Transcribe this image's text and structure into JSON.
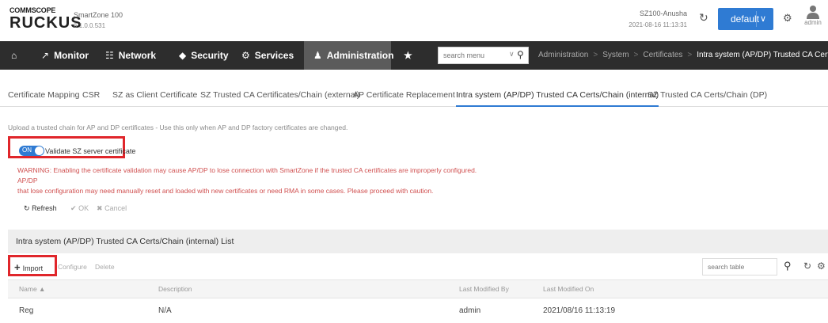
{
  "header": {
    "logo_top": "COMMSCOPE",
    "logo_main": "RUCKUS",
    "product_name": "SmartZone 100",
    "product_version": "6.1.0.0.531",
    "host_name": "SZ100-Anusha",
    "host_time": "2021-08-16  11:13:31",
    "domain_button": "default",
    "user_label": "admin"
  },
  "nav": {
    "items": [
      {
        "icon": "home-icon",
        "label": ""
      },
      {
        "icon": "monitor-icon",
        "label": "Monitor"
      },
      {
        "icon": "network-icon",
        "label": "Network"
      },
      {
        "icon": "shield-icon",
        "label": "Security"
      },
      {
        "icon": "gears-icon",
        "label": "Services"
      },
      {
        "icon": "admin-user-icon",
        "label": "Administration"
      },
      {
        "icon": "star-icon",
        "label": ""
      }
    ],
    "active": "Administration",
    "search_placeholder": "search menu",
    "breadcrumb": [
      "Administration",
      "System",
      "Certificates",
      "Intra system (AP/DP) Trusted CA Certs/Chain (int"
    ]
  },
  "tabs": [
    "Certificate Mapping",
    "CSR",
    "SZ as Client Certificate",
    "SZ Trusted CA Certificates/Chain (external)",
    "AP Certificate Replacement",
    "Intra system (AP/DP) Trusted CA Certs/Chain (internal)",
    "SZ Trusted CA Certs/Chain (DP)"
  ],
  "active_tab": "Intra system (AP/DP) Trusted CA Certs/Chain (internal)",
  "upload_note": "Upload a trusted chain for AP and DP certificates - Use this only when AP and DP factory certificates are changed.",
  "validate": {
    "toggle_state": "ON",
    "label": "Validate SZ server certificate"
  },
  "warning": {
    "line1": "WARNING: Enabling the certificate validation may cause AP/DP to lose connection with SmartZone if the trusted CA certificates are improperly configured. AP/DP",
    "line2": "that lose configuration may need manually reset and loaded with new certificates or need RMA in some cases. Please proceed with caution."
  },
  "actions": {
    "refresh": "Refresh",
    "ok": "OK",
    "cancel": "Cancel"
  },
  "list": {
    "title": "Intra system (AP/DP) Trusted CA Certs/Chain (internal) List",
    "import": "Import",
    "configure": "Configure",
    "delete": "Delete",
    "search_placeholder": "search table",
    "columns": [
      "Name ▲",
      "Description",
      "Last Modified By",
      "Last Modified On"
    ],
    "rows": [
      [
        "Reg",
        "N/A",
        "admin",
        "2021/08/16 11:13:19"
      ]
    ]
  },
  "colors": {
    "accent_blue": "#2f7bd3",
    "nav_bg": "#2d2d2d",
    "highlight_red": "#e0262b",
    "warning_text": "#d05050"
  }
}
